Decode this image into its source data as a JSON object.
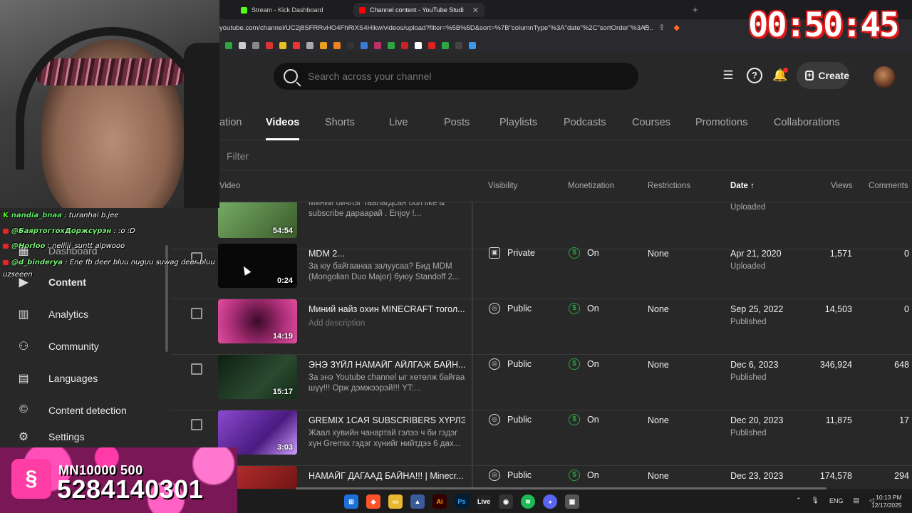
{
  "browser": {
    "tabs": [
      {
        "label": "Stream - Kick Dashboard",
        "fav_color": "#53fc18"
      },
      {
        "label": "Channel content - YouTube Studi",
        "fav_color": "#ff0000"
      }
    ],
    "url": "youtube.com/channel/UC2j8SFRRvHO4FhRiXS4Hlkw/videos/upload?filter=%5B%5D&sort=%7B\"columnType\"%3A\"date\"%2C\"sortOrder\"%3A\"..."
  },
  "timer": "00:50:45",
  "header": {
    "search_placeholder": "Search across your channel",
    "create_label": "Create"
  },
  "tabs": [
    "ation",
    "Videos",
    "Shorts",
    "Live",
    "Posts",
    "Playlists",
    "Podcasts",
    "Courses",
    "Promotions",
    "Collaborations"
  ],
  "filter_label": "Filter",
  "columns": {
    "video": "Video",
    "visibility": "Visibility",
    "monetization": "Monetization",
    "restrictions": "Restrictions",
    "date": "Date",
    "views": "Views",
    "comments": "Comments"
  },
  "sidebar": {
    "items": [
      {
        "label": "Dashboard",
        "icon": "dashboard-icon"
      },
      {
        "label": "Content",
        "icon": "content-icon"
      },
      {
        "label": "Analytics",
        "icon": "analytics-icon"
      },
      {
        "label": "Community",
        "icon": "community-icon"
      },
      {
        "label": "Languages",
        "icon": "languages-icon"
      },
      {
        "label": "Content detection",
        "icon": "copyright-icon"
      },
      {
        "label": "Settings",
        "icon": "gear-icon"
      }
    ]
  },
  "rows": [
    {
      "title": "",
      "desc": "Миний бичлэг таалагдсан бол like & subscribe дараарай . Enjoy !...",
      "duration": "54:54",
      "visibility": "",
      "monetization": "",
      "restrictions": "",
      "date": "",
      "date_status": "Uploaded",
      "views": "",
      "comments": "",
      "thumb": "#5a8a4a"
    },
    {
      "title": "MDM 2...",
      "desc": "За юу байгаанаа залуусаа? Бид MDM (Mongolian Duo Major) буюу Standoff 2...",
      "duration": "0:24",
      "visibility": "Private",
      "vis_icon": "lock-icon",
      "monetization": "On",
      "restrictions": "None",
      "date": "Apr 21, 2020",
      "date_status": "Uploaded",
      "views": "1,571",
      "comments": "0",
      "thumb": "#0a0a0a"
    },
    {
      "title": "Миний найз охин MINECRAFT тогол...",
      "desc": "Add description",
      "duration": "14:19",
      "visibility": "Public",
      "vis_icon": "globe-icon",
      "monetization": "On",
      "restrictions": "None",
      "date": "Sep 25, 2022",
      "date_status": "Published",
      "views": "14,503",
      "comments": "0",
      "thumb": "#b0307a"
    },
    {
      "title": "ЭНЭ ЗҮЙЛ НАМАЙГ АЙЛГАЖ БАЙН...",
      "desc": "За энэ Youtube channel ыг хөтөлж байгаа шүү!!! Орж дэмжээрэй!!! YT:...",
      "duration": "15:17",
      "visibility": "Public",
      "vis_icon": "globe-icon",
      "monetization": "On",
      "restrictions": "None",
      "date": "Dec 6, 2023",
      "date_status": "Published",
      "views": "346,924",
      "comments": "648",
      "thumb": "#1e3a24"
    },
    {
      "title": "GREMIX 1САЯ SUBSCRIBERS ХҮРЛЭ...",
      "desc": "Жаал хувийн чанартай гэлээ ч би гэдэг хүн Gremix гэдэг хүнийг нийтдээ 6 дах...",
      "duration": "3:03",
      "visibility": "Public",
      "vis_icon": "globe-icon",
      "monetization": "On",
      "restrictions": "None",
      "date": "Dec 20, 2023",
      "date_status": "Published",
      "views": "11,875",
      "comments": "17",
      "thumb": "#7a3fb0"
    },
    {
      "title": "НАМАЙГ ДАГААД БАЙНА!!! | Minecr...",
      "desc": "",
      "duration": "",
      "visibility": "Public",
      "vis_icon": "globe-icon",
      "monetization": "On",
      "restrictions": "None",
      "date": "Dec 23, 2023",
      "date_status": "",
      "views": "174,578",
      "comments": "294",
      "thumb": "#8a1a1a"
    }
  ],
  "chat": [
    {
      "user": "nandia_bnaa",
      "msg": " : turanhai b.jee",
      "badge": "kick"
    },
    {
      "user": "@БаяртогтохДоржсүрэн",
      "msg": " : :o :D",
      "badge": "yt"
    },
    {
      "user": "@Horloo",
      "msg": " : neliiii_suntt alpwooo",
      "badge": "yt"
    },
    {
      "user": "@d_binderya",
      "msg": " : Ene fb deer bluu nuguu suwag deer bluu uzseeen",
      "badge": "yt"
    }
  ],
  "banner": {
    "small": "MN10000  500",
    "big": "5284140301"
  },
  "taskbar": {
    "lang": "ENG",
    "time": "10:13 PM",
    "date": "12/17/2025"
  }
}
